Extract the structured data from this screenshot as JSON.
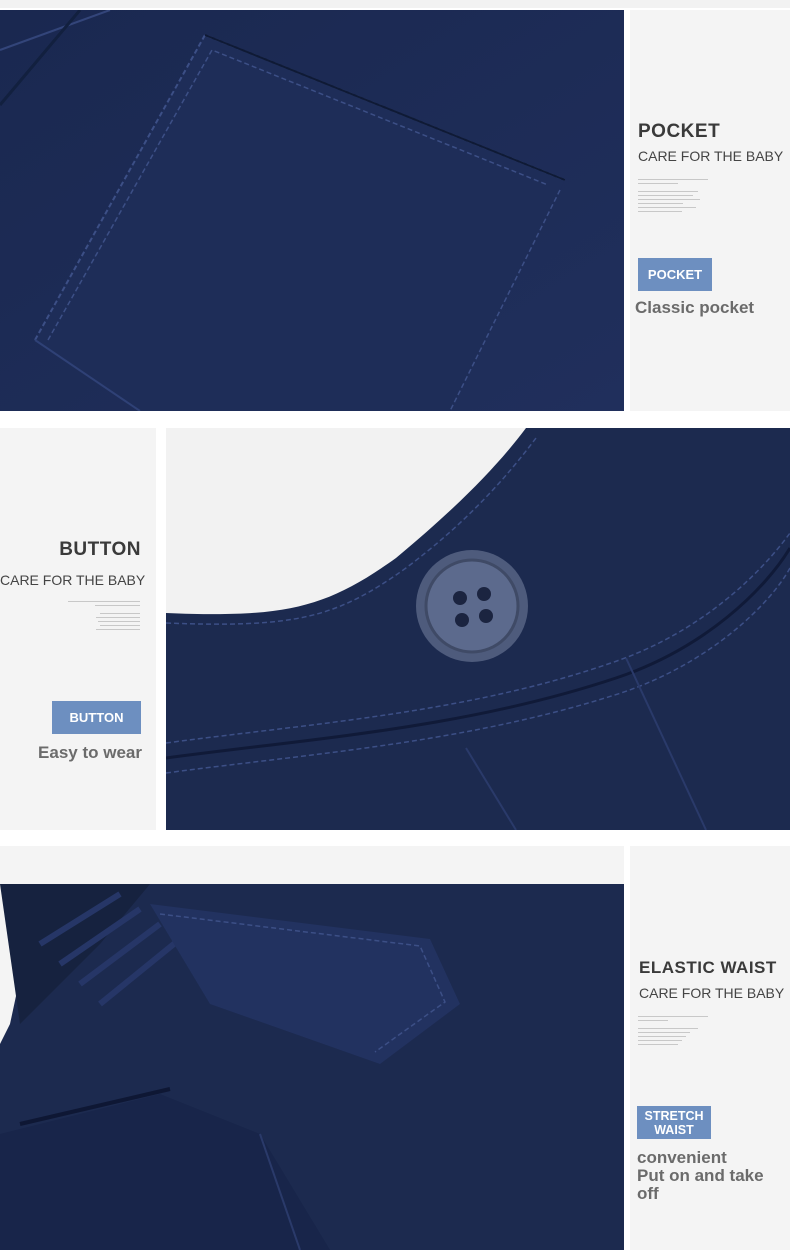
{
  "sections": [
    {
      "title": "POCKET",
      "subtitle": "CARE FOR THE BABY",
      "tag": "POCKET",
      "desc_lines": [
        "Classic pocket"
      ],
      "image": "pocket-closeup"
    },
    {
      "title": "BUTTON",
      "subtitle": "CARE FOR THE BABY",
      "tag": "BUTTON",
      "desc_lines": [
        "Easy to wear"
      ],
      "image": "button-closeup"
    },
    {
      "title": "ELASTIC WAIST",
      "subtitle": "CARE FOR THE BABY",
      "tag": "STRETCH WAIST",
      "desc_lines": [
        "convenient",
        "Put on and take off"
      ],
      "image": "elastic-waist-closeup"
    }
  ],
  "colors": {
    "fabric": "#1c2a4f",
    "tag": "#6d8fc0",
    "panel": "#f4f4f4",
    "stitch": "#3c4f86"
  }
}
